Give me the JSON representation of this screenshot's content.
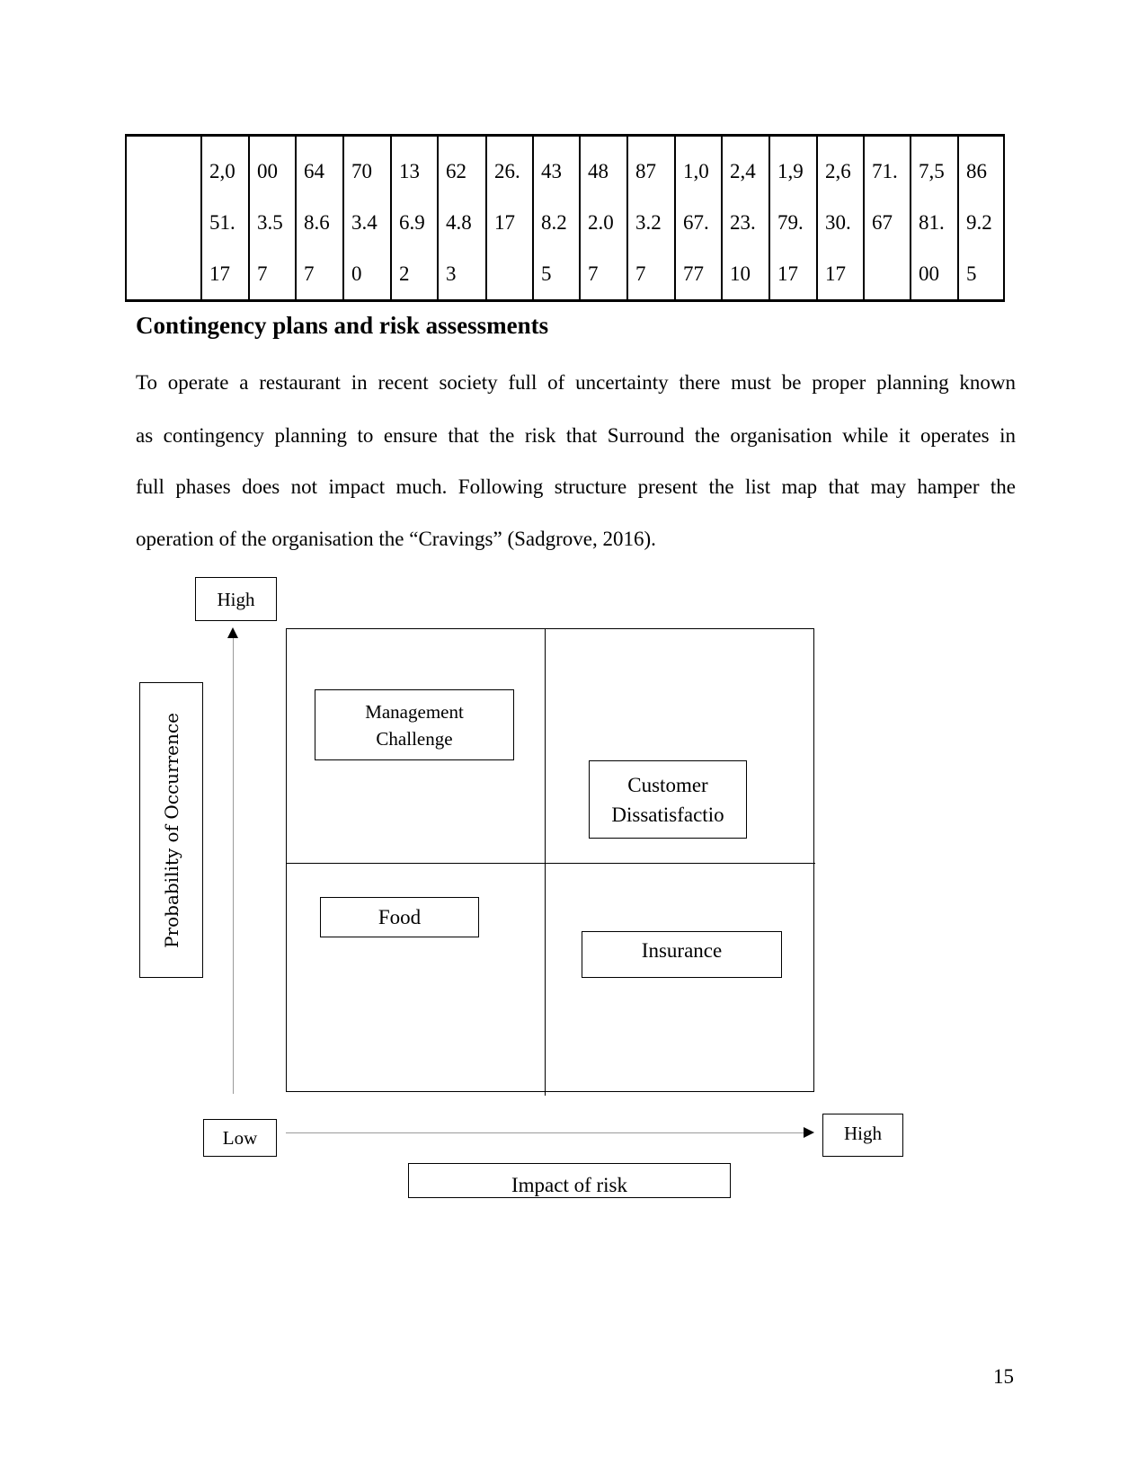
{
  "table": {
    "label_cell": "",
    "cells": [
      [
        "2,0",
        "51.",
        "17"
      ],
      [
        "00",
        "3.5",
        "7"
      ],
      [
        "64",
        "8.6",
        "7"
      ],
      [
        "70",
        "3.4",
        "0"
      ],
      [
        "13",
        "6.9",
        "2"
      ],
      [
        "62",
        "4.8",
        "3"
      ],
      [
        "26.",
        "17",
        ""
      ],
      [
        "43",
        "8.2",
        "5"
      ],
      [
        "48",
        "2.0",
        "7"
      ],
      [
        "87",
        "3.2",
        "7"
      ],
      [
        "1,0",
        "67.",
        "77"
      ],
      [
        "2,4",
        "23.",
        "10"
      ],
      [
        "1,9",
        "79.",
        "17"
      ],
      [
        "2,6",
        "30.",
        "17"
      ],
      [
        "71.",
        "67",
        ""
      ],
      [
        "7,5",
        "81.",
        "00"
      ],
      [
        "86",
        "9.2",
        "5"
      ]
    ]
  },
  "section": {
    "heading": "Contingency plans and risk assessments",
    "paragraph_lines": [
      "To operate a restaurant in recent society full of uncertainty there must be proper planning known",
      "as contingency planning to ensure that the risk that Surround the organisation while it operates in",
      "full phases does not impact much. Following structure present the list map that may hamper the",
      "operation of the organisation the “Cravings” (Sadgrove, 2016)."
    ]
  },
  "risk_matrix": {
    "y_axis": {
      "label": "Probability of Occurrence",
      "high_label": "High",
      "low_label": "Low"
    },
    "x_axis": {
      "label": "Impact of risk",
      "high_label": "High"
    },
    "quadrant_items": [
      {
        "quadrant": "high-probability-low-impact",
        "lines": [
          "Management",
          "Challenge"
        ]
      },
      {
        "quadrant": "high-probability-high-impact",
        "lines": [
          "Customer",
          "Dissatisfactio"
        ]
      },
      {
        "quadrant": "low-probability-low-impact",
        "lines": [
          "Food"
        ]
      },
      {
        "quadrant": "low-probability-high-impact",
        "lines": [
          "Insurance"
        ]
      }
    ]
  },
  "footer": {
    "page_number": "15"
  }
}
